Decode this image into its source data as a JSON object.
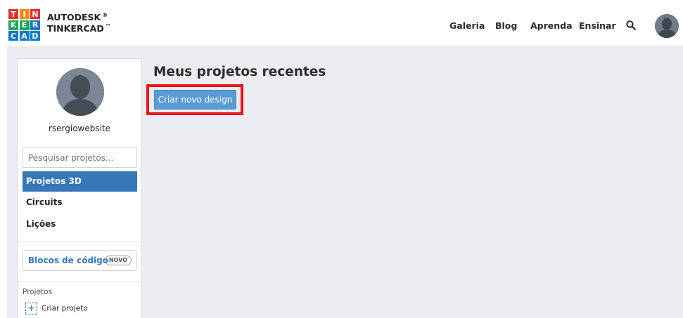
{
  "header": {
    "logo_letters": [
      "T",
      "I",
      "N",
      "K",
      "E",
      "R",
      "C",
      "A",
      "D"
    ],
    "brand_line1": "AUTODESK",
    "brand_line1_mark": "®",
    "brand_line2": "TINKERCAD",
    "brand_line2_mark": "™",
    "nav": [
      "Galeria",
      "Blog",
      "Aprenda",
      "Ensinar"
    ],
    "icons": {
      "search": "search-icon",
      "avatar": "user-avatar"
    }
  },
  "sidebar": {
    "username": "rsergiowebsite",
    "search_placeholder": "Pesquisar projetos...",
    "items": [
      {
        "label": "Projetos 3D",
        "active": true
      },
      {
        "label": "Circuits",
        "active": false
      },
      {
        "label": "Lições",
        "active": false
      }
    ],
    "code_blocks_label": "Blocos de código",
    "new_badge": "NOVO",
    "projects_heading": "Projetos",
    "create_project_label": "Criar projeto"
  },
  "main": {
    "title": "Meus projetos recentes",
    "create_button": "Criar novo design"
  },
  "colors": {
    "accent_blue": "#3677b8",
    "button_blue": "#5b9bd5",
    "highlight_red": "#e8171c",
    "background": "#ebedf0"
  }
}
